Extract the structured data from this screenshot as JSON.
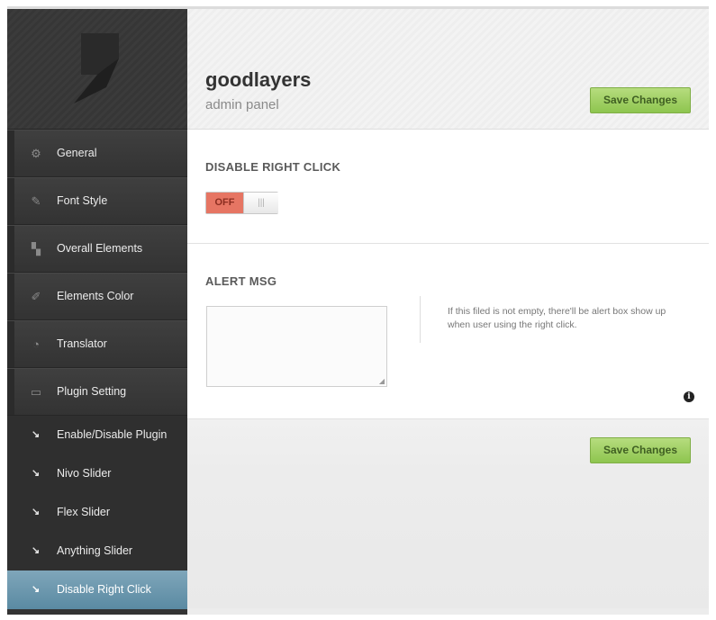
{
  "sidebar": {
    "logo_icon": "goodlayers-logo",
    "items": [
      {
        "label": "General",
        "icon": "gear-icon",
        "glyph": "⚙"
      },
      {
        "label": "Font Style",
        "icon": "pencil-icon",
        "glyph": "✎"
      },
      {
        "label": "Overall Elements",
        "icon": "layout-icon",
        "glyph": "▚"
      },
      {
        "label": "Elements Color",
        "icon": "paintbrush-icon",
        "glyph": "✐"
      },
      {
        "label": "Translator",
        "icon": "pacman-icon",
        "glyph": "◔"
      },
      {
        "label": "Plugin Setting",
        "icon": "monitor-icon",
        "glyph": "▭"
      }
    ],
    "sub_items": [
      {
        "label": "Enable/Disable Plugin"
      },
      {
        "label": "Nivo Slider"
      },
      {
        "label": "Flex Slider"
      },
      {
        "label": "Anything Slider"
      },
      {
        "label": "Disable Right Click",
        "active": true
      }
    ],
    "sub_glyph": "↘"
  },
  "header": {
    "title": "goodlayers",
    "subtitle": "admin panel",
    "save_label": "Save Changes"
  },
  "disable_right_click": {
    "title": "DISABLE RIGHT CLICK",
    "toggle_label": "OFF",
    "toggle_knob": "|||",
    "toggle_state": "off"
  },
  "alert_msg": {
    "title": "ALERT MSG",
    "value": "",
    "hint": "If this filed is not empty, there'll be alert box show up when user using the right click.",
    "info_glyph": "i"
  },
  "footer": {
    "save_label": "Save Changes"
  },
  "colors": {
    "accent_green": "#8ec54f",
    "toggle_off": "#e67563",
    "active_nav": "#6b95ab"
  }
}
